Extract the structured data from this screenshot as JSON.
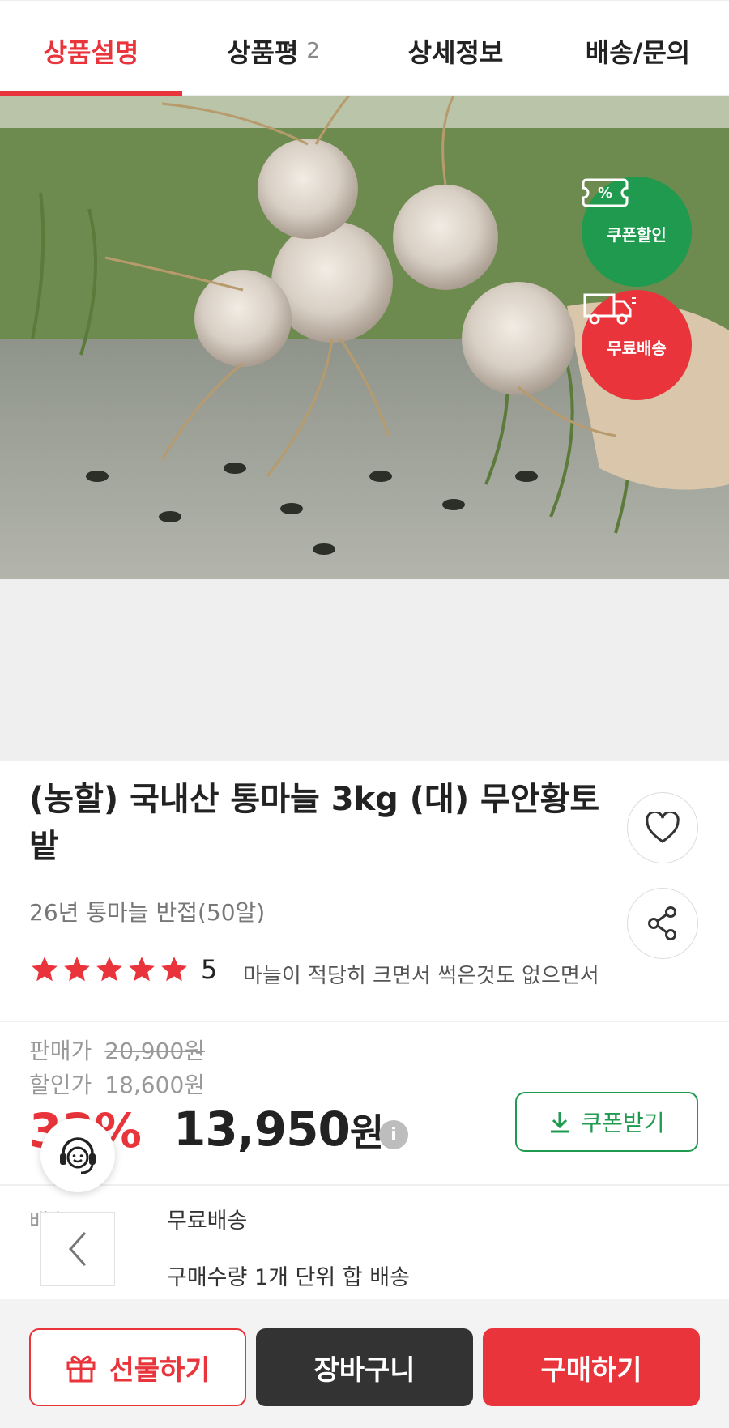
{
  "tabs": [
    {
      "label": "상품설명",
      "count": ""
    },
    {
      "label": "상품평",
      "count": "2"
    },
    {
      "label": "상세정보",
      "count": ""
    },
    {
      "label": "배송/문의",
      "count": ""
    }
  ],
  "badges": {
    "coupon": {
      "symbol": "%",
      "label": "쿠폰할인"
    },
    "free_shipping": {
      "label": "무료배송"
    }
  },
  "product": {
    "title": "(농할) 국내산 통마늘 3kg (대) 무안황토밭",
    "subtitle": "26년 통마늘 반접(50알)",
    "rating": "5",
    "review_snippet": "마늘이 적당히 크면서 썩은것도 없으면서"
  },
  "price": {
    "sale_label": "판매가",
    "sale_value": "20,900원",
    "discount_label": "할인가",
    "discount_value": "18,600원",
    "discount_rate": "33%",
    "final": "13,950",
    "final_unit": "원",
    "info_symbol": "i",
    "coupon_button": "쿠폰받기"
  },
  "shipping": {
    "label": "배송",
    "value": "무료배송",
    "note": "구매수량 1개 단위 합 배송"
  },
  "bottom_bar": {
    "gift": "선물하기",
    "cart": "장바구니",
    "buy": "구매하기"
  },
  "colors": {
    "accent": "#e8343a",
    "coupon_green": "#1f9a4f",
    "dark_button": "#333333"
  }
}
